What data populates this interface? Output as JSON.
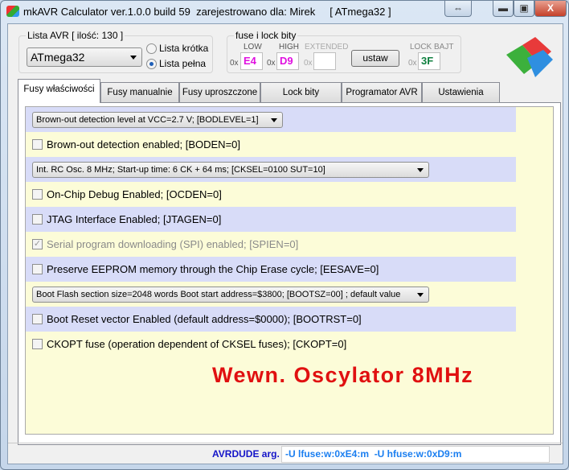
{
  "window": {
    "title": "mkAVR Calculator ver.1.0.0 build 59  zarejestrowano dla: Mirek     [ ATmega32 ]",
    "resize_icon": "⇔",
    "minimize_icon": "▬",
    "maximize_icon": "▣",
    "close_icon": "X"
  },
  "avr_list": {
    "label": "Lista AVR [ ilość: 130 ]",
    "selected": "ATmega32",
    "radio_short": "Lista krótka",
    "radio_full": "Lista pełna"
  },
  "fuses": {
    "label": "fuse i lock bity",
    "low_label": "LOW",
    "high_label": "HIGH",
    "ext_label": "EXTENDED",
    "lock_label": "LOCK BAJT",
    "prefix": "0x",
    "low": "E4",
    "high": "D9",
    "ext": "",
    "lock": "3F",
    "set_button": "ustaw",
    "low_color": "#e010e0",
    "high_color": "#e010e0",
    "lock_color": "#108040"
  },
  "tabs": [
    "Fusy właściwości",
    "Fusy manualnie",
    "Fusy uproszczone",
    "Lock bity",
    "Programator AVR",
    "Ustawienia"
  ],
  "rows": [
    {
      "type": "select",
      "text": "Brown-out detection level at VCC=2.7 V; [BODLEVEL=1]"
    },
    {
      "type": "check",
      "text": "Brown-out detection enabled; [BODEN=0]",
      "checked": false
    },
    {
      "type": "select",
      "text": "Int. RC Osc. 8 MHz; Start-up time: 6 CK + 64 ms; [CKSEL=0100 SUT=10]"
    },
    {
      "type": "check",
      "text": "On-Chip Debug Enabled; [OCDEN=0]",
      "checked": false
    },
    {
      "type": "check",
      "text": "JTAG Interface Enabled; [JTAGEN=0]",
      "checked": false
    },
    {
      "type": "check",
      "text": "Serial program downloading (SPI) enabled; [SPIEN=0]",
      "checked": true,
      "disabled": true
    },
    {
      "type": "check",
      "text": "Preserve EEPROM memory through the Chip Erase cycle; [EESAVE=0]",
      "checked": false
    },
    {
      "type": "select",
      "text": "Boot Flash section size=2048 words Boot start address=$3800; [BOOTSZ=00] ; default value"
    },
    {
      "type": "check",
      "text": "Boot Reset vector Enabled (default address=$0000); [BOOTRST=0]",
      "checked": false
    },
    {
      "type": "check",
      "text": "CKOPT fuse (operation dependent of CKSEL fuses); [CKOPT=0]",
      "checked": false
    }
  ],
  "summary": "Wewn. Oscylator 8MHz",
  "status": {
    "label": "AVRDUDE arg.",
    "value": "-U lfuse:w:0xE4:m  -U hfuse:w:0xD9:m"
  }
}
